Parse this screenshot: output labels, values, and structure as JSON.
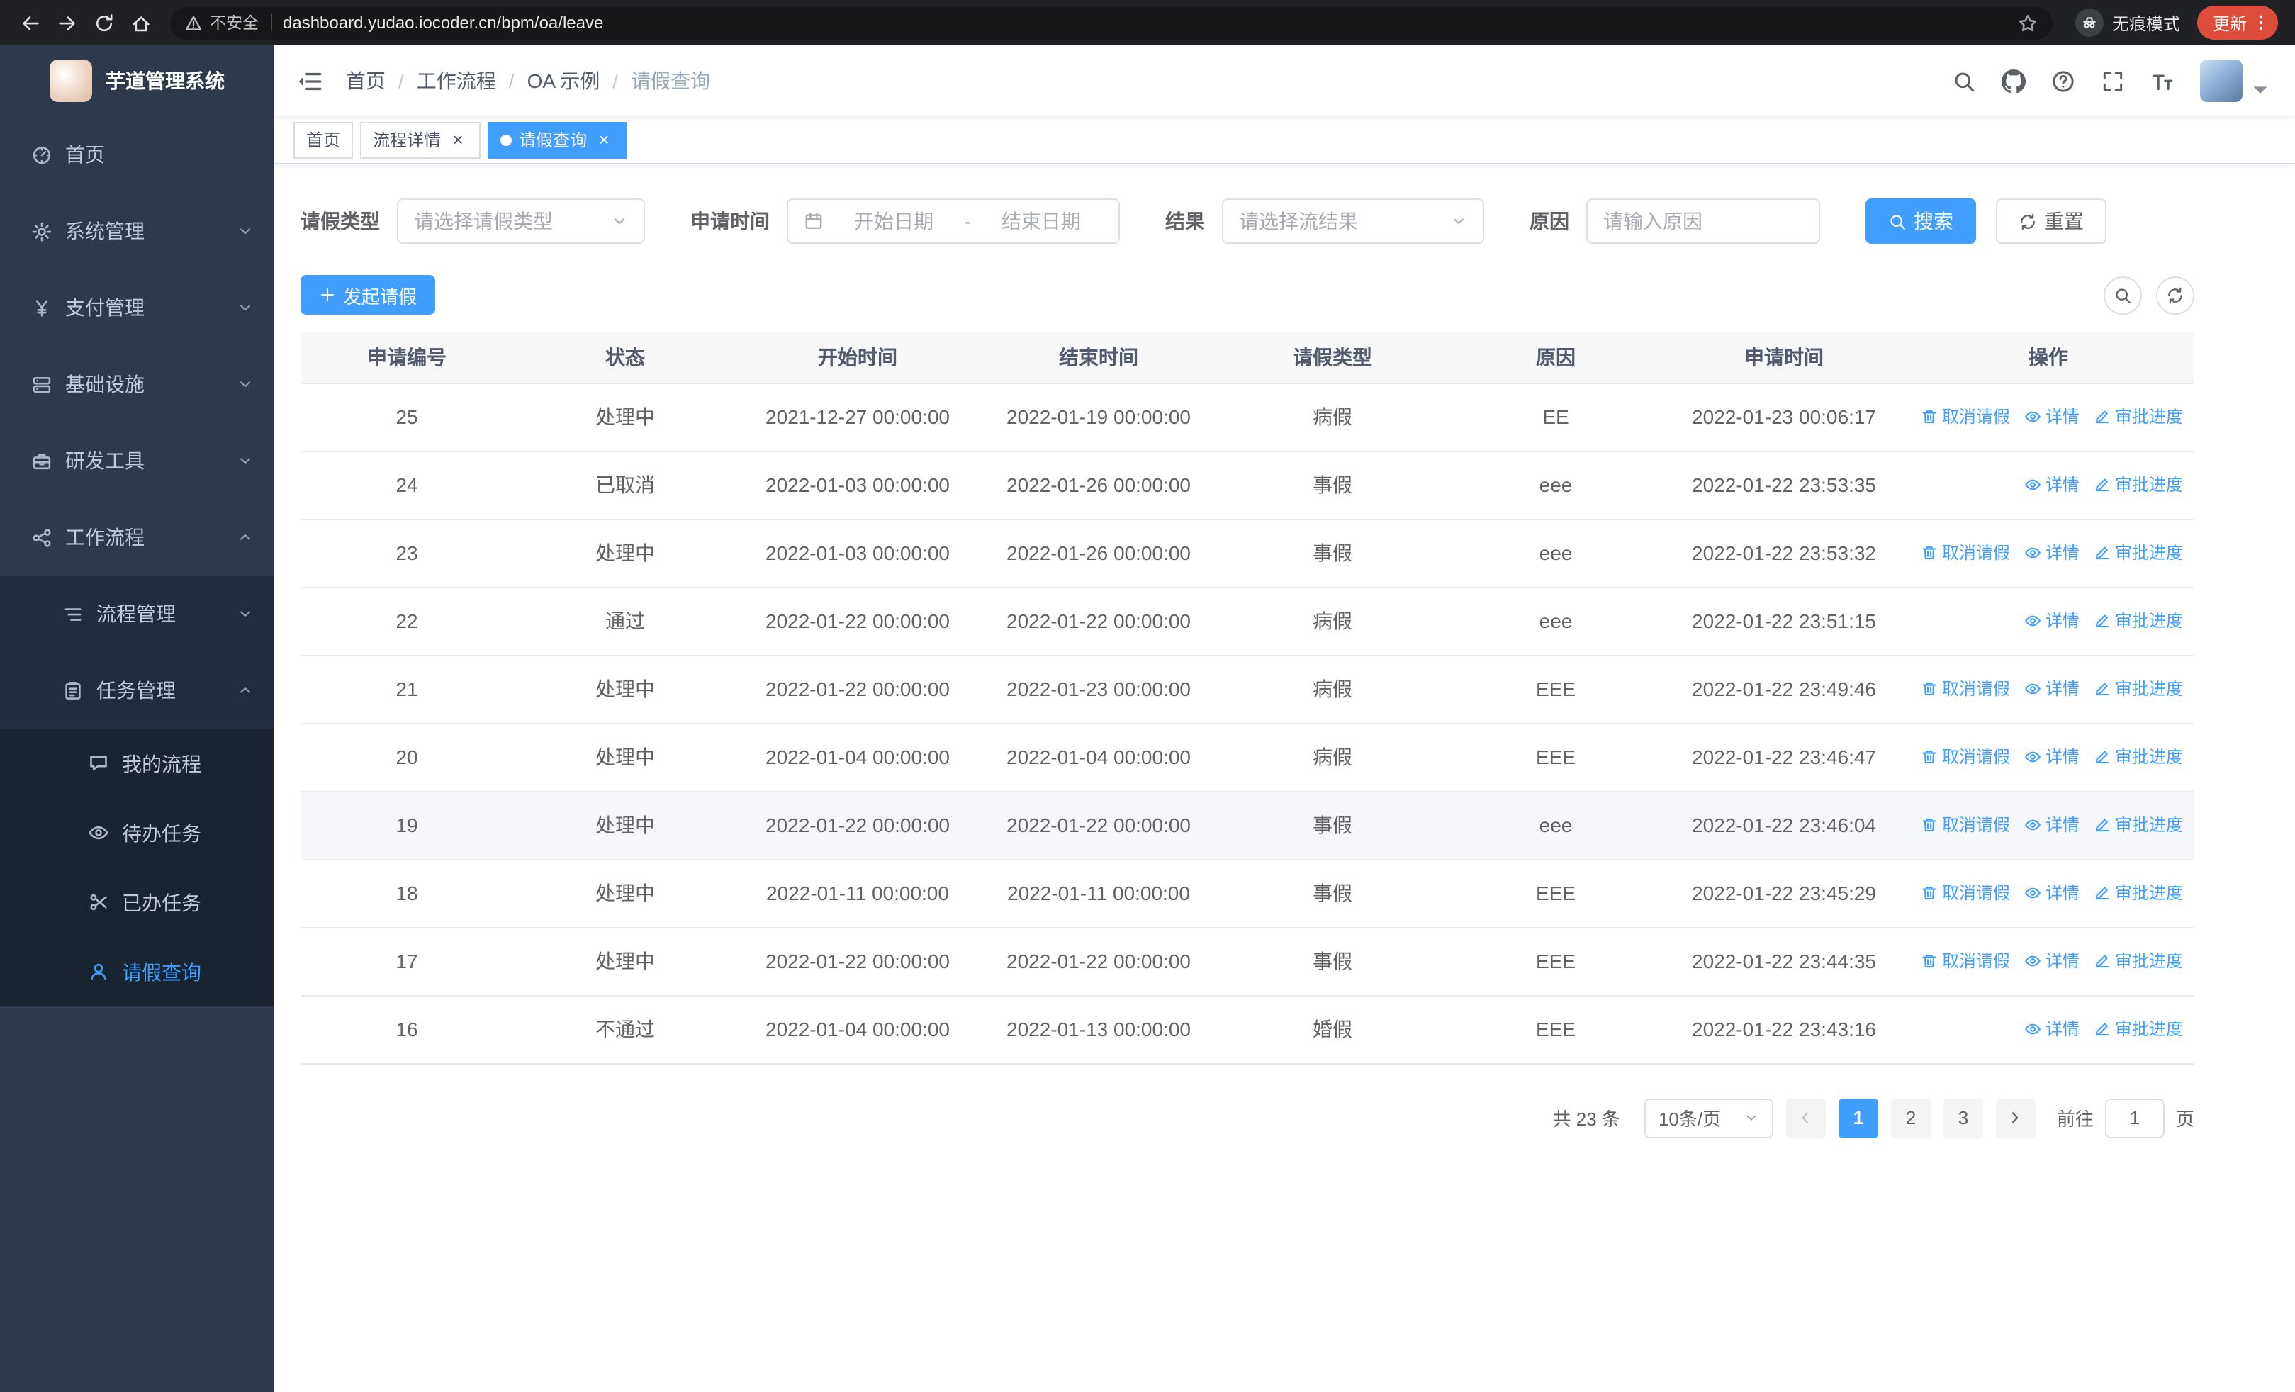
{
  "colors": {
    "accent": "#409eff",
    "sidebar_bg": "#2d3a4b",
    "submenu_bg": "#1f2d3d",
    "update_badge": "#dd4b39"
  },
  "browser": {
    "security_label": "不安全",
    "url": "dashboard.yudao.iocoder.cn/bpm/oa/leave",
    "incognito_label": "无痕模式",
    "update_label": "更新"
  },
  "sidebar": {
    "title": "芋道管理系统",
    "items": [
      {
        "name": "home",
        "label": "首页",
        "icon": "dashboard-icon",
        "level": 1
      },
      {
        "name": "system-management",
        "label": "系统管理",
        "icon": "gear-icon",
        "level": 1,
        "chevron": "down"
      },
      {
        "name": "payment-management",
        "label": "支付管理",
        "icon": "yen-icon",
        "level": 1,
        "chevron": "down"
      },
      {
        "name": "infrastructure",
        "label": "基础设施",
        "icon": "server-icon",
        "level": 1,
        "chevron": "down"
      },
      {
        "name": "dev-tools",
        "label": "研发工具",
        "icon": "toolbox-icon",
        "level": 1,
        "chevron": "down"
      },
      {
        "name": "workflow",
        "label": "工作流程",
        "icon": "share-nodes-icon",
        "level": 1,
        "chevron": "up"
      },
      {
        "name": "process-management",
        "label": "流程管理",
        "icon": "list-icon",
        "level": 2,
        "chevron": "down"
      },
      {
        "name": "task-management",
        "label": "任务管理",
        "icon": "clipboard-icon",
        "level": 2,
        "chevron": "up"
      },
      {
        "name": "my-processes",
        "label": "我的流程",
        "icon": "chat-icon",
        "level": 3
      },
      {
        "name": "pending-tasks",
        "label": "待办任务",
        "icon": "eye-icon",
        "level": 3
      },
      {
        "name": "completed-tasks",
        "label": "已办任务",
        "icon": "scissors-icon",
        "level": 3
      },
      {
        "name": "leave-query",
        "label": "请假查询",
        "icon": "user-icon",
        "level": 3,
        "active": true
      }
    ]
  },
  "header": {
    "breadcrumb": [
      "首页",
      "工作流程",
      "OA 示例",
      "请假查询"
    ]
  },
  "tabs": [
    {
      "name": "home",
      "label": "首页",
      "closable": false,
      "active": false
    },
    {
      "name": "process-detail",
      "label": "流程详情",
      "closable": true,
      "active": false
    },
    {
      "name": "leave-query",
      "label": "请假查询",
      "closable": true,
      "active": true
    }
  ],
  "filters": {
    "leave_type_label": "请假类型",
    "leave_type_placeholder": "请选择请假类型",
    "apply_time_label": "申请时间",
    "start_date_placeholder": "开始日期",
    "range_separator": "-",
    "end_date_placeholder": "结束日期",
    "result_label": "结果",
    "result_placeholder": "请选择流结果",
    "reason_label": "原因",
    "reason_placeholder": "请输入原因",
    "search_label": "搜索",
    "reset_label": "重置"
  },
  "toolbar": {
    "create_label": "发起请假"
  },
  "table": {
    "columns": [
      "申请编号",
      "状态",
      "开始时间",
      "结束时间",
      "请假类型",
      "原因",
      "申请时间",
      "操作"
    ],
    "action_defs": {
      "cancel": {
        "label": "取消请假",
        "icon": "delete-icon",
        "name": "cancel-leave-link"
      },
      "detail": {
        "label": "详情",
        "icon": "eye-icon",
        "name": "detail-link"
      },
      "progress": {
        "label": "审批进度",
        "icon": "edit-icon",
        "name": "approval-progress-link"
      }
    },
    "rows": [
      {
        "cells": [
          "25",
          "处理中",
          "2021-12-27 00:00:00",
          "2022-01-19 00:00:00",
          "病假",
          "EE",
          "2022-01-23 00:06:17"
        ],
        "actions": [
          "cancel",
          "detail",
          "progress"
        ]
      },
      {
        "cells": [
          "24",
          "已取消",
          "2022-01-03 00:00:00",
          "2022-01-26 00:00:00",
          "事假",
          "eee",
          "2022-01-22 23:53:35"
        ],
        "actions": [
          "detail",
          "progress"
        ]
      },
      {
        "cells": [
          "23",
          "处理中",
          "2022-01-03 00:00:00",
          "2022-01-26 00:00:00",
          "事假",
          "eee",
          "2022-01-22 23:53:32"
        ],
        "actions": [
          "cancel",
          "detail",
          "progress"
        ]
      },
      {
        "cells": [
          "22",
          "通过",
          "2022-01-22 00:00:00",
          "2022-01-22 00:00:00",
          "病假",
          "eee",
          "2022-01-22 23:51:15"
        ],
        "actions": [
          "detail",
          "progress"
        ]
      },
      {
        "cells": [
          "21",
          "处理中",
          "2022-01-22 00:00:00",
          "2022-01-23 00:00:00",
          "病假",
          "EEE",
          "2022-01-22 23:49:46"
        ],
        "actions": [
          "cancel",
          "detail",
          "progress"
        ]
      },
      {
        "cells": [
          "20",
          "处理中",
          "2022-01-04 00:00:00",
          "2022-01-04 00:00:00",
          "病假",
          "EEE",
          "2022-01-22 23:46:47"
        ],
        "actions": [
          "cancel",
          "detail",
          "progress"
        ]
      },
      {
        "cells": [
          "19",
          "处理中",
          "2022-01-22 00:00:00",
          "2022-01-22 00:00:00",
          "事假",
          "eee",
          "2022-01-22 23:46:04"
        ],
        "actions": [
          "cancel",
          "detail",
          "progress"
        ],
        "hover": true
      },
      {
        "cells": [
          "18",
          "处理中",
          "2022-01-11 00:00:00",
          "2022-01-11 00:00:00",
          "事假",
          "EEE",
          "2022-01-22 23:45:29"
        ],
        "actions": [
          "cancel",
          "detail",
          "progress"
        ]
      },
      {
        "cells": [
          "17",
          "处理中",
          "2022-01-22 00:00:00",
          "2022-01-22 00:00:00",
          "事假",
          "EEE",
          "2022-01-22 23:44:35"
        ],
        "actions": [
          "cancel",
          "detail",
          "progress"
        ]
      },
      {
        "cells": [
          "16",
          "不通过",
          "2022-01-04 00:00:00",
          "2022-01-13 00:00:00",
          "婚假",
          "EEE",
          "2022-01-22 23:43:16"
        ],
        "actions": [
          "detail",
          "progress"
        ]
      }
    ]
  },
  "pagination": {
    "total_label": "共 23 条",
    "page_size_value": "10条/页",
    "pages": [
      "1",
      "2",
      "3"
    ],
    "active_page": "1",
    "goto_label": "前往",
    "goto_value": "1",
    "goto_suffix": "页"
  }
}
